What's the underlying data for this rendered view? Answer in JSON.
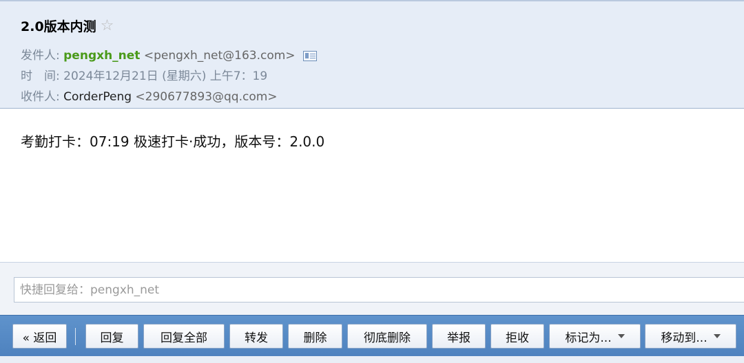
{
  "mail": {
    "subject": "2.0版本内测",
    "from_label": "发件人:",
    "from_name": "pengxh_net",
    "from_email": "<pengxh_net@163.com>",
    "time_label": "时　间:",
    "time_value": "2024年12月21日 (星期六) 上午7：19",
    "to_label": "收件人:",
    "to_name": "CorderPeng",
    "to_email": "<290677893@qq.com>",
    "body": "考勤打卡：07:19 极速打卡·成功，版本号：2.0.0"
  },
  "quick_reply": {
    "placeholder": "快捷回复给：pengxh_net"
  },
  "toolbar": {
    "back": "« 返回",
    "reply": "回复",
    "reply_all": "回复全部",
    "forward": "转发",
    "delete": "删除",
    "delete_perm": "彻底删除",
    "report": "举报",
    "reject": "拒收",
    "mark_as": "标记为...",
    "move_to": "移动到..."
  }
}
